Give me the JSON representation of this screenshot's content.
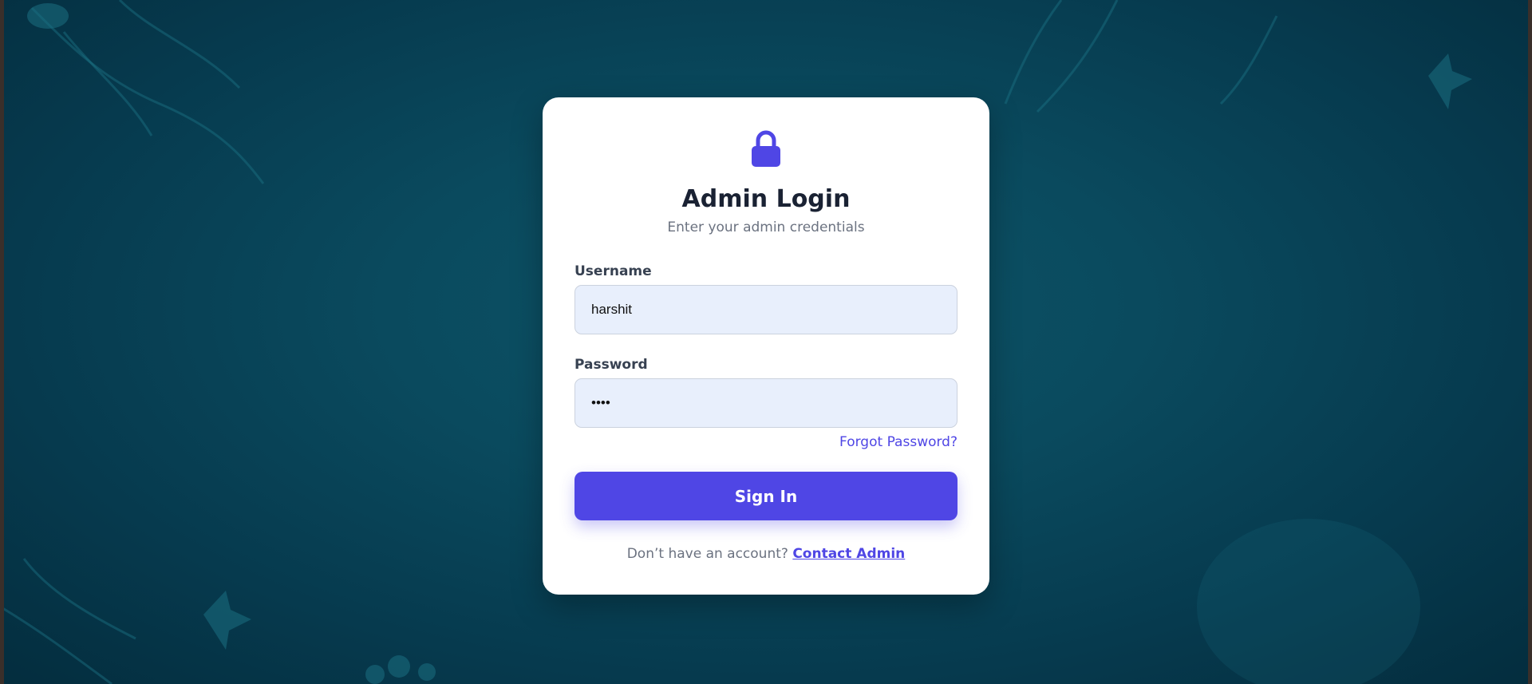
{
  "colors": {
    "background": "#0a4a5e",
    "card": "#ffffff",
    "accent": "#4f46e5",
    "input_fill": "#e8effc",
    "title_text": "#1a2233",
    "muted_text": "#6b7280"
  },
  "header": {
    "icon": "lock-icon",
    "title": "Admin Login",
    "subtitle": "Enter your admin credentials"
  },
  "form": {
    "username": {
      "label": "Username",
      "value": "harshit"
    },
    "password": {
      "label": "Password",
      "value": "••••"
    },
    "forgot_link": "Forgot Password?",
    "submit_label": "Sign In"
  },
  "footer": {
    "prompt": "Don’t have an account?",
    "link": "Contact Admin"
  }
}
